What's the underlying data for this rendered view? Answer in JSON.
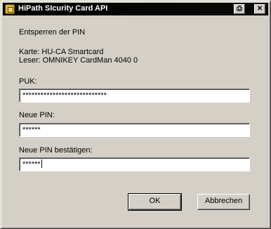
{
  "window": {
    "title": "HiPath SIcurity Card API"
  },
  "titlebar_buttons": {
    "print_icon": "printer-icon",
    "close_glyph": "✕"
  },
  "dialog": {
    "heading": "Entsperren der PIN",
    "card_line": "Karte: HU-CA Smartcard",
    "reader_line": "Leser: OMNIKEY CardMan 4040 0"
  },
  "fields": {
    "puk": {
      "label": "PUK:",
      "value": "****************************"
    },
    "new_pin": {
      "label": "Neue PIN:",
      "value": "******"
    },
    "confirm_pin": {
      "label": "Neue PIN bestätigen:",
      "value": "******"
    }
  },
  "buttons": {
    "ok": "OK",
    "cancel": "Abbrechen"
  }
}
